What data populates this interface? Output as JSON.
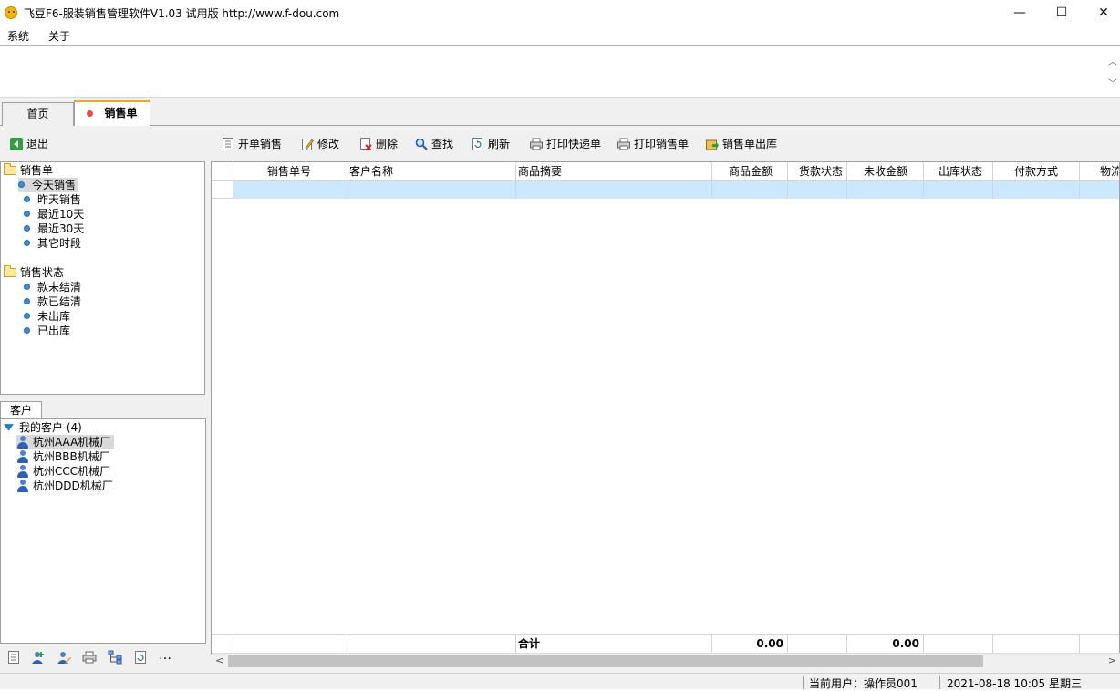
{
  "window": {
    "title": "飞豆F6-服装销售管理软件V1.03 试用版 http://www.f-dou.com",
    "minimize": "—",
    "maximize": "☐",
    "close": "✕"
  },
  "menu": {
    "system": "系统",
    "about": "关于"
  },
  "tabs": {
    "home": "首页",
    "sales": "销售单"
  },
  "toolbar": {
    "exit": "退出",
    "new_sale": "开单销售",
    "edit": "修改",
    "delete": "删除",
    "search": "查找",
    "refresh": "刷新",
    "print_express": "打印快递单",
    "print_sale": "打印销售单",
    "ship_out": "销售单出库"
  },
  "nav": {
    "group1": "销售单",
    "items1": [
      "今天销售",
      "昨天销售",
      "最近10天",
      "最近30天",
      "其它时段"
    ],
    "group2": "销售状态",
    "items2": [
      "款未结清",
      "款已结清",
      "未出库",
      "已出库"
    ]
  },
  "customers": {
    "tab": "客户",
    "root": "我的客户 (4)",
    "items": [
      "杭州AAA机械厂",
      "杭州BBB机械厂",
      "杭州CCC机械厂",
      "杭州DDD机械厂"
    ]
  },
  "grid": {
    "columns": [
      "销售单号",
      "客户名称",
      "商品摘要",
      "商品金额",
      "货款状态",
      "未收金额",
      "出库状态",
      "付款方式",
      "物流"
    ],
    "footer": {
      "label": "合计",
      "goods_amount": "0.00",
      "unpaid_amount": "0.00"
    }
  },
  "status": {
    "user": "当前用户：操作员001",
    "datetime": "2021-08-18 10:05 星期三"
  }
}
